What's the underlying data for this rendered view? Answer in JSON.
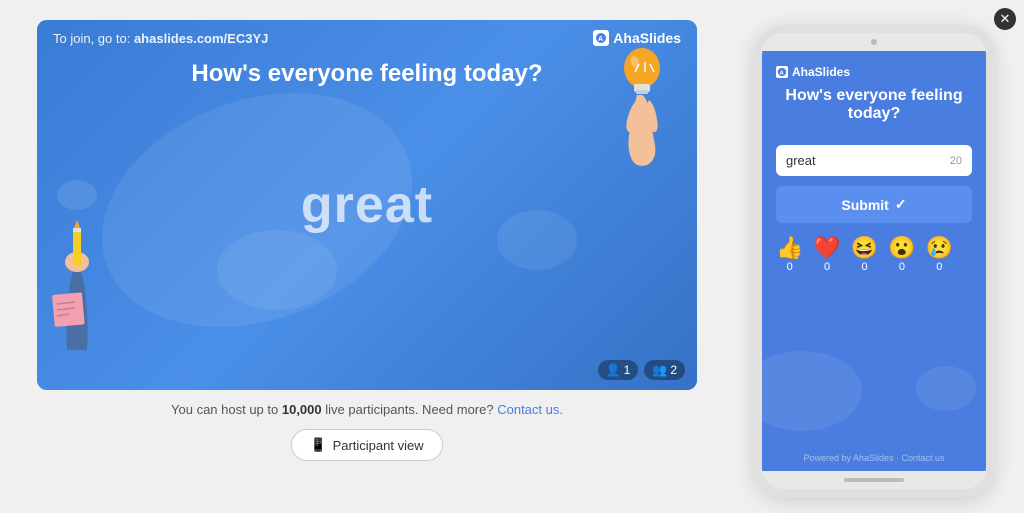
{
  "slide": {
    "join_prefix": "To join, go to: ",
    "join_url": "ahaslides.com/EC3YJ",
    "logo": "AhaSlides",
    "title": "How's everyone feeling today?",
    "word": "great",
    "badge_participants": "1",
    "badge_users": "2"
  },
  "info": {
    "text_prefix": "You can host up to ",
    "limit": "10,000",
    "text_suffix": " live participants. Need more? ",
    "contact_link": "Contact us."
  },
  "participant_btn": {
    "label": "Participant view",
    "icon": "mobile-icon"
  },
  "phone": {
    "logo": "AhaSlides",
    "title": "How's everyone feeling today?",
    "input_value": "great",
    "input_count": "20",
    "submit_label": "Submit",
    "submit_check": "✓",
    "powered_by": "Powered by AhaSlides · Contact us",
    "reactions": [
      {
        "emoji": "👍",
        "count": "0",
        "name": "thumbs-up"
      },
      {
        "emoji": "❤️",
        "count": "0",
        "name": "heart"
      },
      {
        "emoji": "😆",
        "count": "0",
        "name": "laugh"
      },
      {
        "emoji": "😮",
        "count": "0",
        "name": "wow"
      },
      {
        "emoji": "😢",
        "count": "0",
        "name": "sad"
      }
    ]
  },
  "close_btn": {
    "label": "✕"
  }
}
